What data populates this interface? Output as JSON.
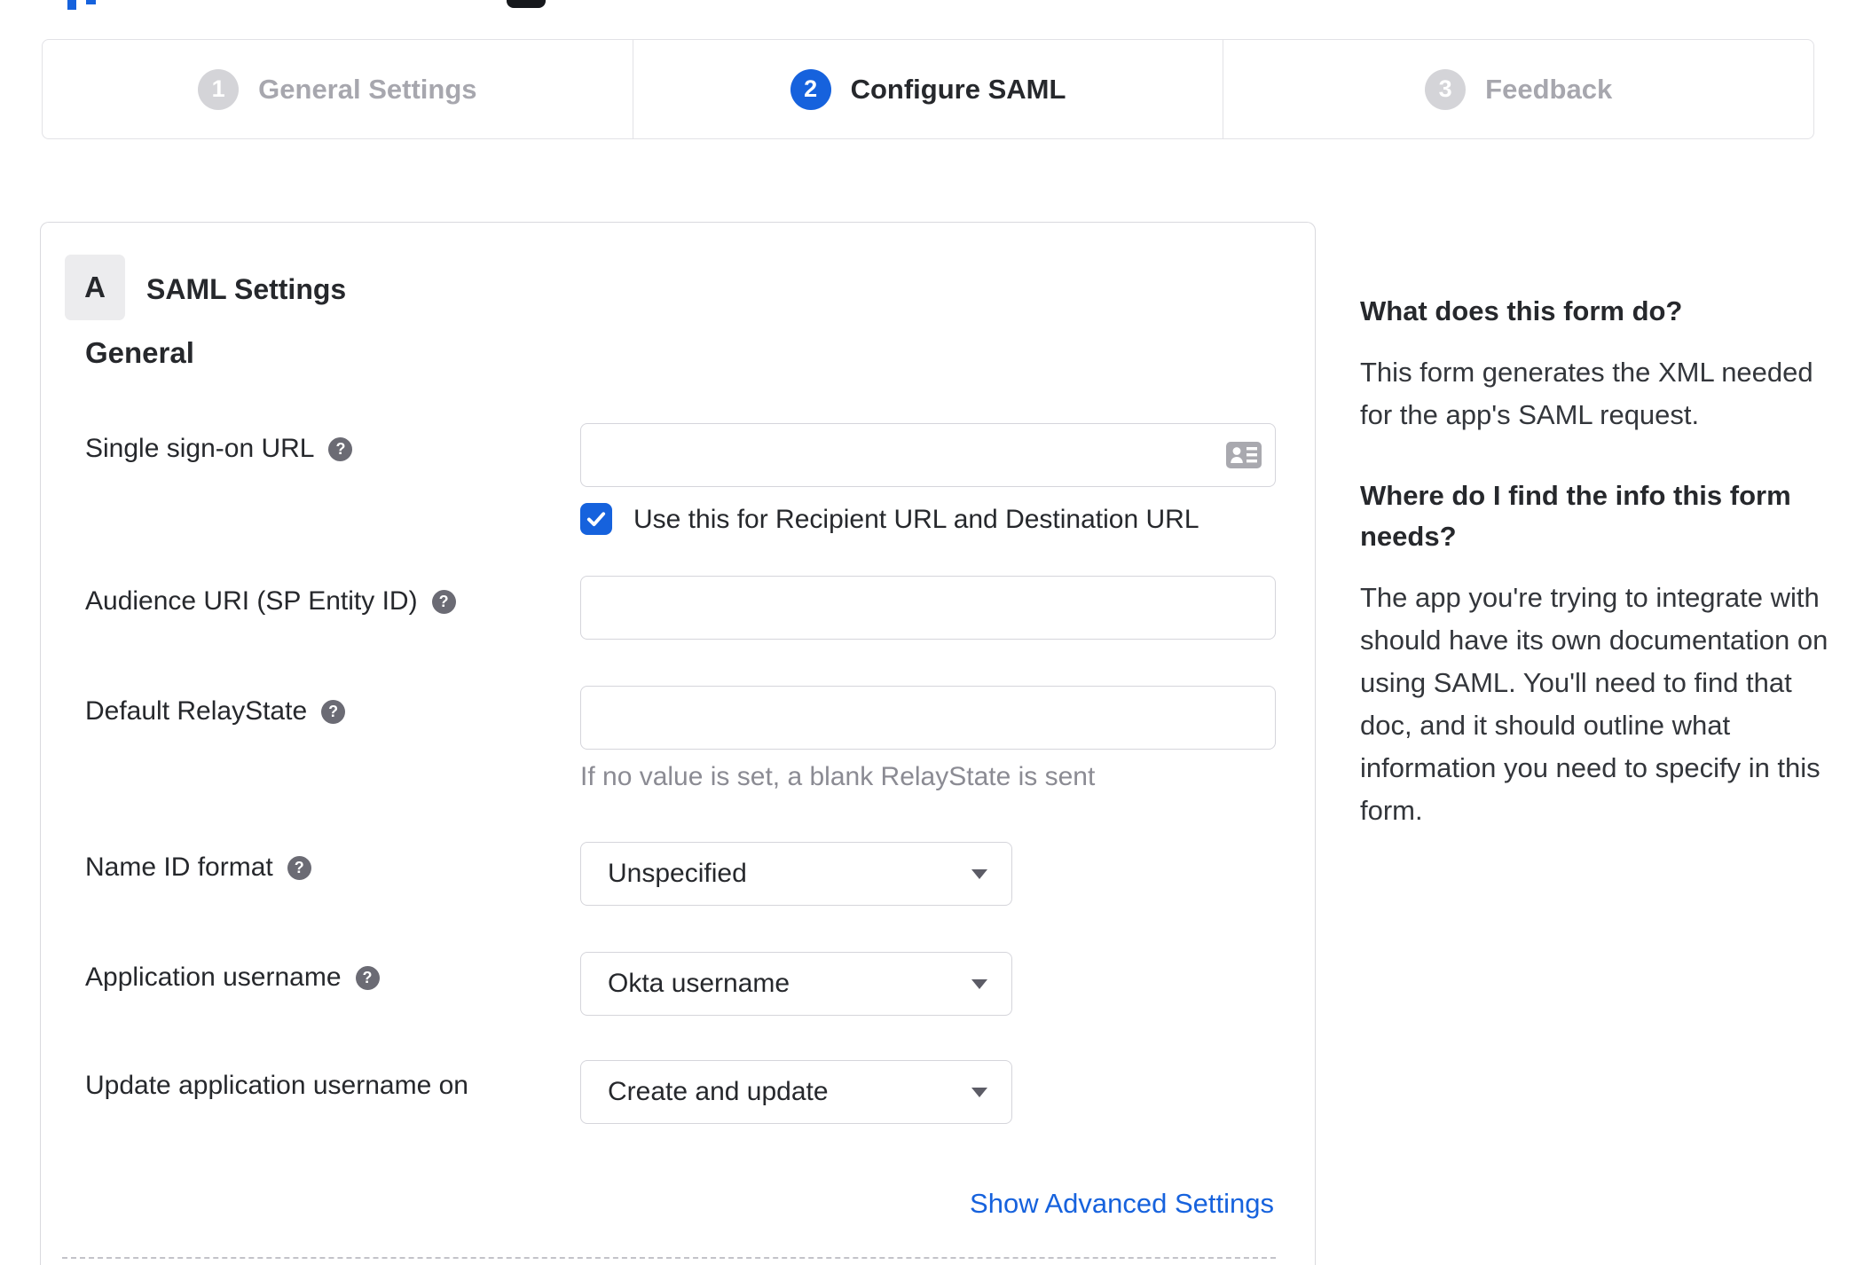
{
  "colors": {
    "accent_blue": "#1662dd",
    "inactive_gray": "#d4d4d8",
    "text_dark": "#26282c",
    "hint_gray": "#8b8b93",
    "border_gray": "#d5d5db"
  },
  "stepper": {
    "steps": [
      {
        "number": "1",
        "label": "General Settings",
        "state": "inactive"
      },
      {
        "number": "2",
        "label": "Configure SAML",
        "state": "active"
      },
      {
        "number": "3",
        "label": "Feedback",
        "state": "inactive"
      }
    ]
  },
  "panel": {
    "section_badge": "A",
    "section_title": "SAML Settings",
    "subsection_title": "General",
    "fields": [
      {
        "label": "Single sign-on URL",
        "type": "text",
        "value": "",
        "placeholder": "",
        "checkbox": {
          "checked": true,
          "label": "Use this for Recipient URL and Destination URL"
        }
      },
      {
        "label": "Audience URI (SP Entity ID)",
        "type": "text",
        "value": "",
        "placeholder": ""
      },
      {
        "label": "Default RelayState",
        "type": "text",
        "value": "",
        "placeholder": "",
        "hint": "If no value is set, a blank RelayState is sent"
      },
      {
        "label": "Name ID format",
        "type": "select",
        "value": "Unspecified"
      },
      {
        "label": "Application username",
        "type": "select",
        "value": "Okta username"
      },
      {
        "label": "Update application username on",
        "type": "select",
        "value": "Create and update"
      }
    ],
    "show_advanced_label": "Show Advanced Settings"
  },
  "sidebar": {
    "heading1": "What does this form do?",
    "para1": "This form generates the XML needed for the app's SAML request.",
    "heading2": "Where do I find the info this form needs?",
    "para2": "The app you're trying to integrate with should have its own documentation on using SAML. You'll need to find that doc, and it should outline what information you need to specify in this form."
  }
}
